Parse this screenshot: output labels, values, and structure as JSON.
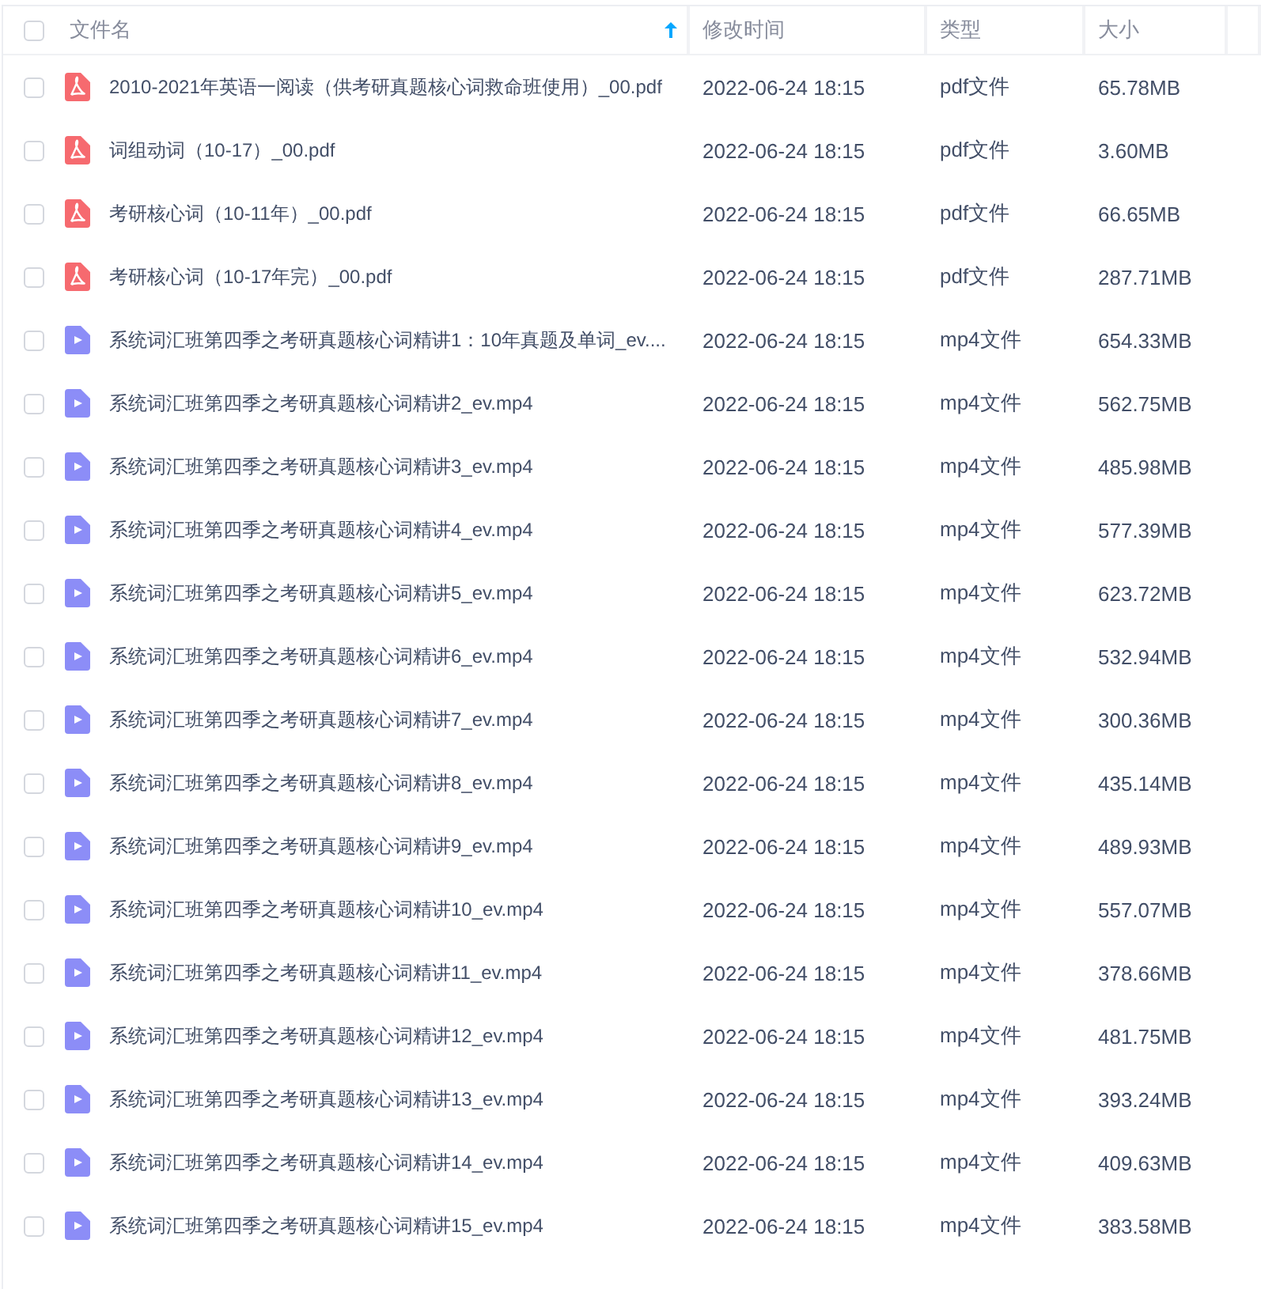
{
  "header": {
    "select_all": {
      "checked": false
    },
    "columns": [
      {
        "label": "文件名",
        "sort_ascending": true
      },
      {
        "label": "修改时间",
        "sort_ascending": false
      },
      {
        "label": "类型",
        "sort_ascending": false
      },
      {
        "label": "大小",
        "sort_ascending": false
      }
    ]
  },
  "rows": [
    {
      "checked": false,
      "kind": "pdf",
      "name": "2010-2021年英语一阅读（供考研真题核心词救命班使用）_00.pdf",
      "modified": "2022-06-24 18:15",
      "type": "pdf文件",
      "size": "65.78MB"
    },
    {
      "checked": false,
      "kind": "pdf",
      "name": "词组动词（10-17）_00.pdf",
      "modified": "2022-06-24 18:15",
      "type": "pdf文件",
      "size": "3.60MB"
    },
    {
      "checked": false,
      "kind": "pdf",
      "name": "考研核心词（10-11年）_00.pdf",
      "modified": "2022-06-24 18:15",
      "type": "pdf文件",
      "size": "66.65MB"
    },
    {
      "checked": false,
      "kind": "pdf",
      "name": "考研核心词（10-17年完）_00.pdf",
      "modified": "2022-06-24 18:15",
      "type": "pdf文件",
      "size": "287.71MB"
    },
    {
      "checked": false,
      "kind": "video",
      "name": "系统词汇班第四季之考研真题核心词精讲1：10年真题及单词_ev....",
      "modified": "2022-06-24 18:15",
      "type": "mp4文件",
      "size": "654.33MB"
    },
    {
      "checked": false,
      "kind": "video",
      "name": "系统词汇班第四季之考研真题核心词精讲2_ev.mp4",
      "modified": "2022-06-24 18:15",
      "type": "mp4文件",
      "size": "562.75MB"
    },
    {
      "checked": false,
      "kind": "video",
      "name": "系统词汇班第四季之考研真题核心词精讲3_ev.mp4",
      "modified": "2022-06-24 18:15",
      "type": "mp4文件",
      "size": "485.98MB"
    },
    {
      "checked": false,
      "kind": "video",
      "name": "系统词汇班第四季之考研真题核心词精讲4_ev.mp4",
      "modified": "2022-06-24 18:15",
      "type": "mp4文件",
      "size": "577.39MB"
    },
    {
      "checked": false,
      "kind": "video",
      "name": "系统词汇班第四季之考研真题核心词精讲5_ev.mp4",
      "modified": "2022-06-24 18:15",
      "type": "mp4文件",
      "size": "623.72MB"
    },
    {
      "checked": false,
      "kind": "video",
      "name": "系统词汇班第四季之考研真题核心词精讲6_ev.mp4",
      "modified": "2022-06-24 18:15",
      "type": "mp4文件",
      "size": "532.94MB"
    },
    {
      "checked": false,
      "kind": "video",
      "name": "系统词汇班第四季之考研真题核心词精讲7_ev.mp4",
      "modified": "2022-06-24 18:15",
      "type": "mp4文件",
      "size": "300.36MB"
    },
    {
      "checked": false,
      "kind": "video",
      "name": "系统词汇班第四季之考研真题核心词精讲8_ev.mp4",
      "modified": "2022-06-24 18:15",
      "type": "mp4文件",
      "size": "435.14MB"
    },
    {
      "checked": false,
      "kind": "video",
      "name": "系统词汇班第四季之考研真题核心词精讲9_ev.mp4",
      "modified": "2022-06-24 18:15",
      "type": "mp4文件",
      "size": "489.93MB"
    },
    {
      "checked": false,
      "kind": "video",
      "name": "系统词汇班第四季之考研真题核心词精讲10_ev.mp4",
      "modified": "2022-06-24 18:15",
      "type": "mp4文件",
      "size": "557.07MB"
    },
    {
      "checked": false,
      "kind": "video",
      "name": "系统词汇班第四季之考研真题核心词精讲11_ev.mp4",
      "modified": "2022-06-24 18:15",
      "type": "mp4文件",
      "size": "378.66MB"
    },
    {
      "checked": false,
      "kind": "video",
      "name": "系统词汇班第四季之考研真题核心词精讲12_ev.mp4",
      "modified": "2022-06-24 18:15",
      "type": "mp4文件",
      "size": "481.75MB"
    },
    {
      "checked": false,
      "kind": "video",
      "name": "系统词汇班第四季之考研真题核心词精讲13_ev.mp4",
      "modified": "2022-06-24 18:15",
      "type": "mp4文件",
      "size": "393.24MB"
    },
    {
      "checked": false,
      "kind": "video",
      "name": "系统词汇班第四季之考研真题核心词精讲14_ev.mp4",
      "modified": "2022-06-24 18:15",
      "type": "mp4文件",
      "size": "409.63MB"
    },
    {
      "checked": false,
      "kind": "video",
      "name": "系统词汇班第四季之考研真题核心词精讲15_ev.mp4",
      "modified": "2022-06-24 18:15",
      "type": "mp4文件",
      "size": "383.58MB"
    }
  ]
}
